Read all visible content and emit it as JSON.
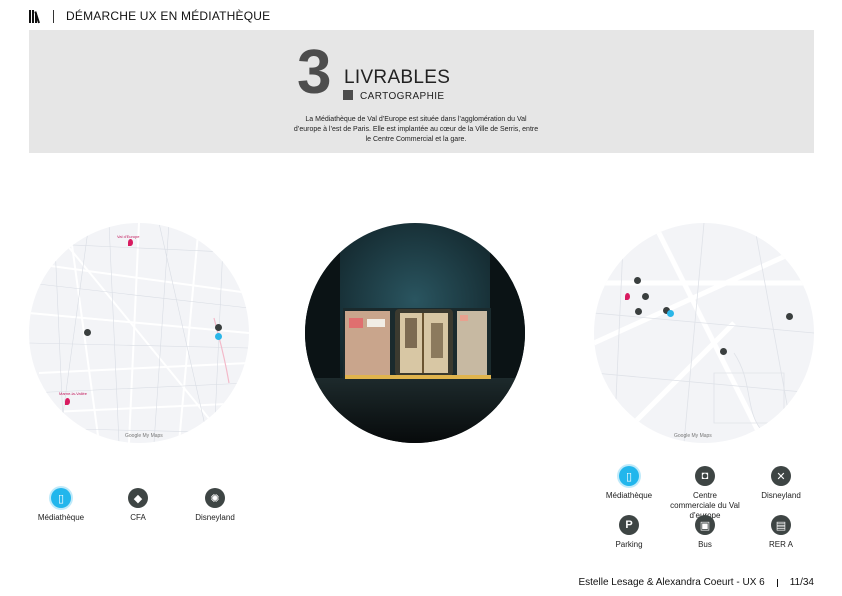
{
  "header": {
    "title": "DÉMARCHE UX EN MÉDIATHÈQUE",
    "logo_icon": "library-books-icon"
  },
  "section": {
    "number": "3",
    "title": "LIVRABLES",
    "subtitle": "CARTOGRAPHIE",
    "intro": "La Médiathèque de Val d’Europe est située dans l’agglomération du Val d’europe à l’est de Paris. Elle est implantée au cœur de la Ville de Serris, entre le Centre Commercial et la gare."
  },
  "left_map": {
    "google_label": "Google My Maps",
    "icons": [
      "map-pin-icon"
    ]
  },
  "right_map": {
    "google_label": "Google My Maps"
  },
  "left_legend": [
    {
      "label": "Médiathèque",
      "icon": "book-icon",
      "color": "#22b6ec"
    },
    {
      "label": "CFA",
      "icon": "graduation-cap-icon",
      "color": "#3e4544"
    },
    {
      "label": "Disneyland",
      "icon": "ferris-wheel-icon",
      "color": "#3e4544"
    }
  ],
  "right_legend": [
    {
      "label": "Médiathèque",
      "icon": "book-icon",
      "color": "#22b6ec"
    },
    {
      "label": "Centre commerciale du Val d'europe",
      "icon": "shopping-bag-icon",
      "color": "#3e4544"
    },
    {
      "label": "Disneyland",
      "icon": "fork-knife-icon",
      "color": "#3e4544"
    },
    {
      "label": "Parking",
      "icon": "parking-icon",
      "color": "#3e4544"
    },
    {
      "label": "Bus",
      "icon": "bus-icon",
      "color": "#3e4544"
    },
    {
      "label": "RER A",
      "icon": "train-icon",
      "color": "#3e4544"
    }
  ],
  "footer": {
    "authors": "Estelle Lesage & Alexandra Coeurt - UX 6",
    "page": "11/34"
  }
}
